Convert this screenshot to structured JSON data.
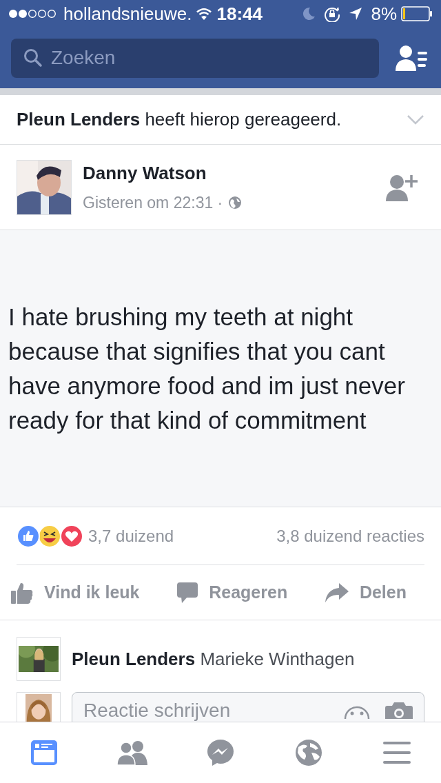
{
  "status_bar": {
    "carrier": "hollandsnieuwe.",
    "time": "18:44",
    "battery": "8%"
  },
  "search": {
    "placeholder": "Zoeken"
  },
  "notification": {
    "text": "**Pleun Lenders** heeft hierop gereageerd."
  },
  "post": {
    "author": "Danny Watson",
    "time": "Gisteren om 22:31 ·",
    "text": "I hate brushing my teeth at night because that signifies that you cant have anymore food and im just never ready for that kind of commitment",
    "reactions_count": "3,7 duizend",
    "comments_count": "3,8 duizend reacties",
    "actions": [
      {
        "kind": "like",
        "label": "Vind ik leuk"
      },
      {
        "kind": "comment",
        "label": "Reageren"
      },
      {
        "kind": "share",
        "label": "Delen"
      }
    ]
  },
  "comments": [
    {
      "author": "Pleun Lenders",
      "text": "Marieke Winthagen"
    }
  ],
  "comment_field": {
    "placeholder": "Reactie schrijven"
  },
  "tab_bar": [
    {
      "kind": "feed",
      "selected": true
    },
    {
      "kind": "friends",
      "selected": false
    },
    {
      "kind": "messenger",
      "selected": false
    },
    {
      "kind": "globe",
      "selected": false
    },
    {
      "kind": "menu",
      "selected": false
    }
  ]
}
